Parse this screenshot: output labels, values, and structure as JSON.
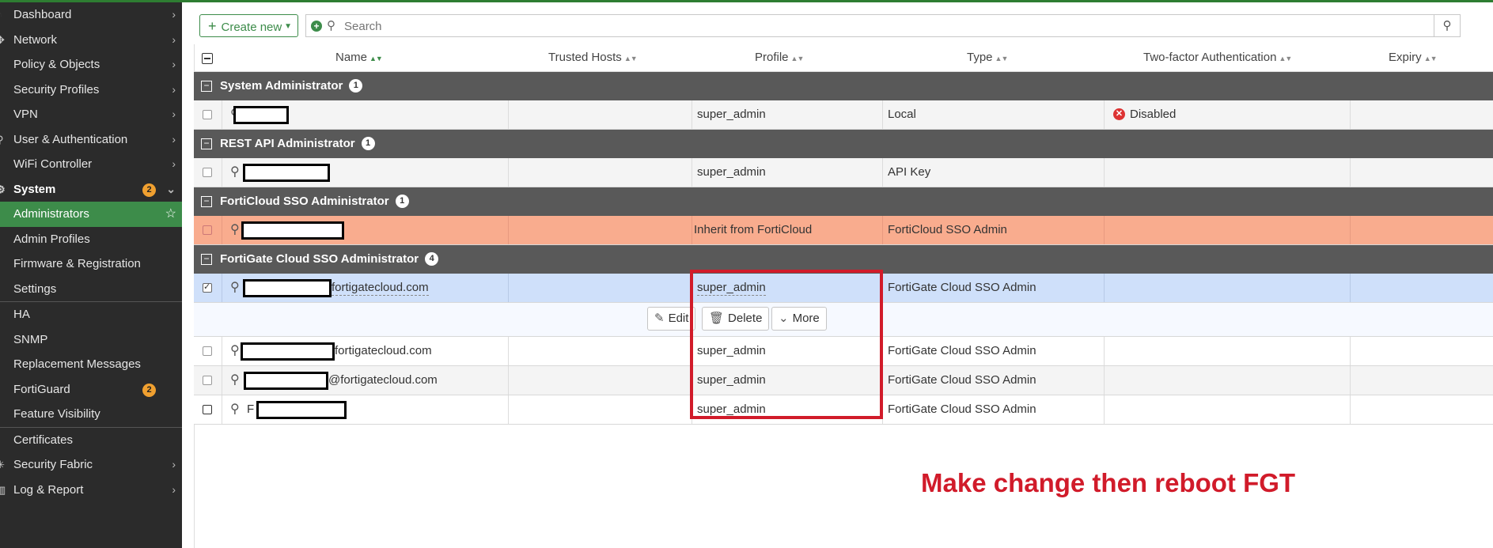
{
  "sidebar": {
    "items": [
      {
        "label": "Dashboard",
        "chevron": "right"
      },
      {
        "label": "Network",
        "chevron": "right"
      },
      {
        "label": "Policy & Objects",
        "chevron": "right"
      },
      {
        "label": "Security Profiles",
        "chevron": "right"
      },
      {
        "label": "VPN",
        "chevron": "right"
      },
      {
        "label": "User & Authentication",
        "chevron": "right"
      },
      {
        "label": "WiFi Controller",
        "chevron": "right"
      },
      {
        "label": "System",
        "badge": "2",
        "chevron": "down"
      },
      {
        "label": "Administrators"
      },
      {
        "label": "Admin Profiles"
      },
      {
        "label": "Firmware & Registration"
      },
      {
        "label": "Settings"
      },
      {
        "label": "HA"
      },
      {
        "label": "SNMP"
      },
      {
        "label": "Replacement Messages"
      },
      {
        "label": "FortiGuard",
        "badge": "2"
      },
      {
        "label": "Feature Visibility"
      },
      {
        "label": "Certificates"
      },
      {
        "label": "Security Fabric",
        "chevron": "right"
      },
      {
        "label": "Log & Report",
        "chevron": "right"
      }
    ]
  },
  "toolbar": {
    "create_label": "Create new",
    "search_placeholder": "Search"
  },
  "table": {
    "columns": [
      "Name",
      "Trusted Hosts",
      "Profile",
      "Type",
      "Two-factor Authentication",
      "Expiry"
    ],
    "groups": [
      {
        "title": "System Administrator",
        "count": "1",
        "rows": [
          {
            "name_suffix": "",
            "profile": "super_admin",
            "type": "Local",
            "two_factor": "Disabled"
          }
        ]
      },
      {
        "title": "REST API Administrator",
        "count": "1",
        "rows": [
          {
            "name_suffix": "",
            "profile": "super_admin",
            "type": "API Key",
            "two_factor": ""
          }
        ]
      },
      {
        "title": "FortiCloud SSO Administrator",
        "count": "1",
        "rows": [
          {
            "name_suffix": "",
            "profile": "Inherit from FortiCloud",
            "type": "FortiCloud SSO Admin",
            "two_factor": ""
          }
        ]
      },
      {
        "title": "FortiGate Cloud SSO Administrator",
        "count": "4",
        "rows": [
          {
            "name_suffix": "fortigatecloud.com",
            "profile": "super_admin",
            "type": "FortiGate Cloud SSO Admin",
            "two_factor": ""
          },
          {
            "name_suffix": "fortigatecloud.com",
            "profile": "super_admin",
            "type": "FortiGate Cloud SSO Admin",
            "two_factor": ""
          },
          {
            "name_suffix": "@fortigatecloud.com",
            "profile": "super_admin",
            "type": "FortiGate Cloud SSO Admin",
            "two_factor": ""
          },
          {
            "name_prefix": "F",
            "profile": "super_admin",
            "type": "FortiGate Cloud SSO Admin",
            "two_factor": ""
          }
        ]
      }
    ],
    "actions": {
      "edit": "Edit",
      "delete": "Delete",
      "more": "More"
    }
  },
  "annotation": {
    "text": "Make change then reboot FGT",
    "color": "#d11b2a"
  },
  "colors": {
    "accent": "#3d8c4a",
    "sidebar": "#2b2b2b",
    "group_header": "#595959",
    "selected_row": "#cfe0fa",
    "forticloud_row": "#f9ac8e"
  }
}
